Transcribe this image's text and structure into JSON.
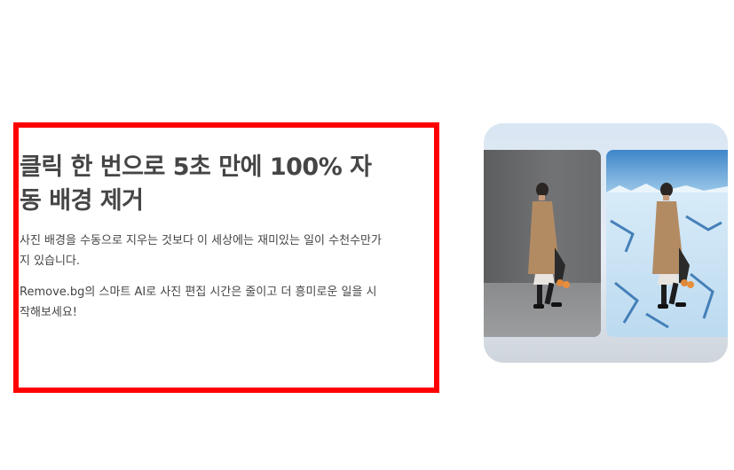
{
  "hero": {
    "headline": "클릭 한 번으로 5초 만에 100% 자동 배경 제거",
    "paragraphs": [
      "사진 배경을 수동으로 지우는 것보다 이 세상에는 재미있는 일이 수천수만가지 있습니다.",
      "Remove.bg의 스마트 AI로 사진 편집 시간은 줄이고 더 흥미로운 일을 시작해보세요!"
    ]
  },
  "colors": {
    "highlight": "#ff0000",
    "text": "#454545"
  }
}
